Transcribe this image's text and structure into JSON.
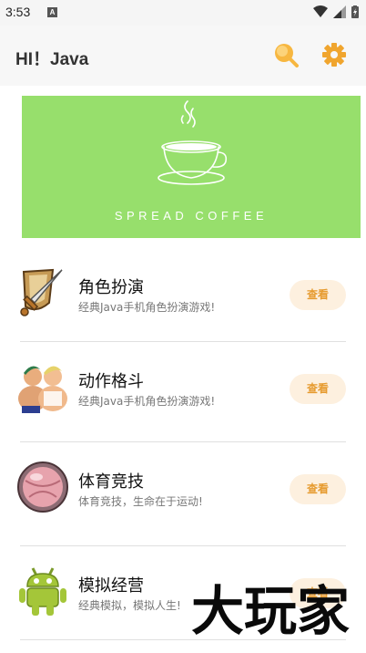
{
  "status": {
    "time": "3:53",
    "notif_letter": "A"
  },
  "appbar": {
    "title": "HI！Java"
  },
  "banner": {
    "brand": "SPREAD COFFEE"
  },
  "items": [
    {
      "name": "角色扮演",
      "desc": "经典Java手机角色扮演游戏!",
      "action": "查看",
      "icon": "sword-shield-icon"
    },
    {
      "name": "动作格斗",
      "desc": "经典Java手机角色扮演游戏!",
      "action": "查看",
      "icon": "fighters-icon"
    },
    {
      "name": "体育竞技",
      "desc": "体育竞技，生命在于运动!",
      "action": "查看",
      "icon": "ball-icon"
    },
    {
      "name": "模拟经营",
      "desc": "经典模拟，模拟人生!",
      "action": "查看",
      "icon": "android-robot-icon"
    }
  ],
  "watermark": {
    "text": "大玩家"
  },
  "colors": {
    "accent": "#e69b2f",
    "banner": "#97df6c",
    "button_bg": "#fdf0df"
  }
}
